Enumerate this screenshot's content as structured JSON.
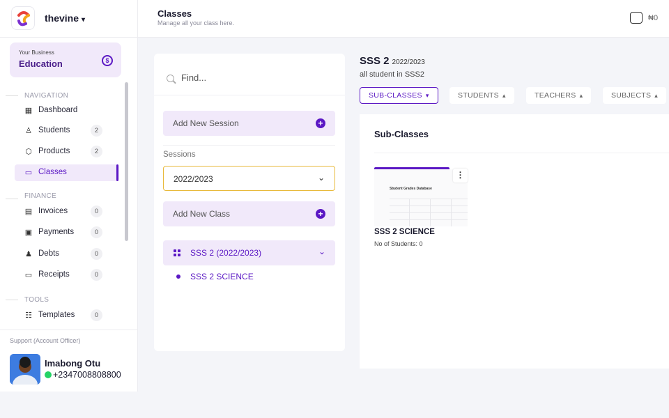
{
  "brand": {
    "name": "thevine",
    "logo_icon": "vine-logo-icon"
  },
  "business": {
    "small_label": "Your Business",
    "name": "Education",
    "switch_icon": "switch-business-icon"
  },
  "sidebar": {
    "sections": {
      "navigation": "NAVIGATION",
      "finance": "FINANCE",
      "tools": "TOOLS"
    },
    "items": [
      {
        "label": "Dashboard",
        "icon": "grid-icon",
        "count": null
      },
      {
        "label": "Students",
        "icon": "user-icon",
        "count": "2"
      },
      {
        "label": "Products",
        "icon": "box-icon",
        "count": "2"
      },
      {
        "label": "Classes",
        "icon": "card-icon",
        "count": null,
        "active": true
      },
      {
        "label": "Invoices",
        "icon": "invoice-icon",
        "count": "0"
      },
      {
        "label": "Payments",
        "icon": "cash-icon",
        "count": "0"
      },
      {
        "label": "Debts",
        "icon": "debt-icon",
        "count": "0"
      },
      {
        "label": "Receipts",
        "icon": "receipt-icon",
        "count": "0"
      },
      {
        "label": "Templates",
        "icon": "template-icon",
        "count": "0"
      }
    ],
    "support": {
      "label": "Support (Account Officer)",
      "name": "Imabong Otu",
      "phone": "+2347008808800"
    }
  },
  "header": {
    "title": "Classes",
    "subtitle": "Manage all your class here.",
    "wallet_amount": "₦0"
  },
  "panel": {
    "search_placeholder": "Find...",
    "add_session": "Add New Session",
    "sessions_label": "Sessions",
    "selected_session": "2022/2023",
    "add_class": "Add New Class",
    "class_group": "SSS 2 (2022/2023)",
    "sub_item": "SSS 2 SCIENCE"
  },
  "class_view": {
    "title": "SSS 2",
    "year": "2022/2023",
    "subtitle": "all student in SSS2",
    "tabs": [
      {
        "label": "SUB-CLASSES",
        "chevron": "▾"
      },
      {
        "label": "STUDENTS",
        "chevron": "▴"
      },
      {
        "label": "TEACHERS",
        "chevron": "▴"
      },
      {
        "label": "SUBJECTS",
        "chevron": "▴"
      }
    ],
    "section_title": "Sub-Classes",
    "card": {
      "thumb_title": "Student Grades Database",
      "name": "SSS 2 SCIENCE",
      "meta": "No of Students: 0"
    }
  },
  "colors": {
    "accent": "#5b18c4",
    "accent_soft": "#f1e9fa",
    "highlight_border": "#e8b93a"
  }
}
